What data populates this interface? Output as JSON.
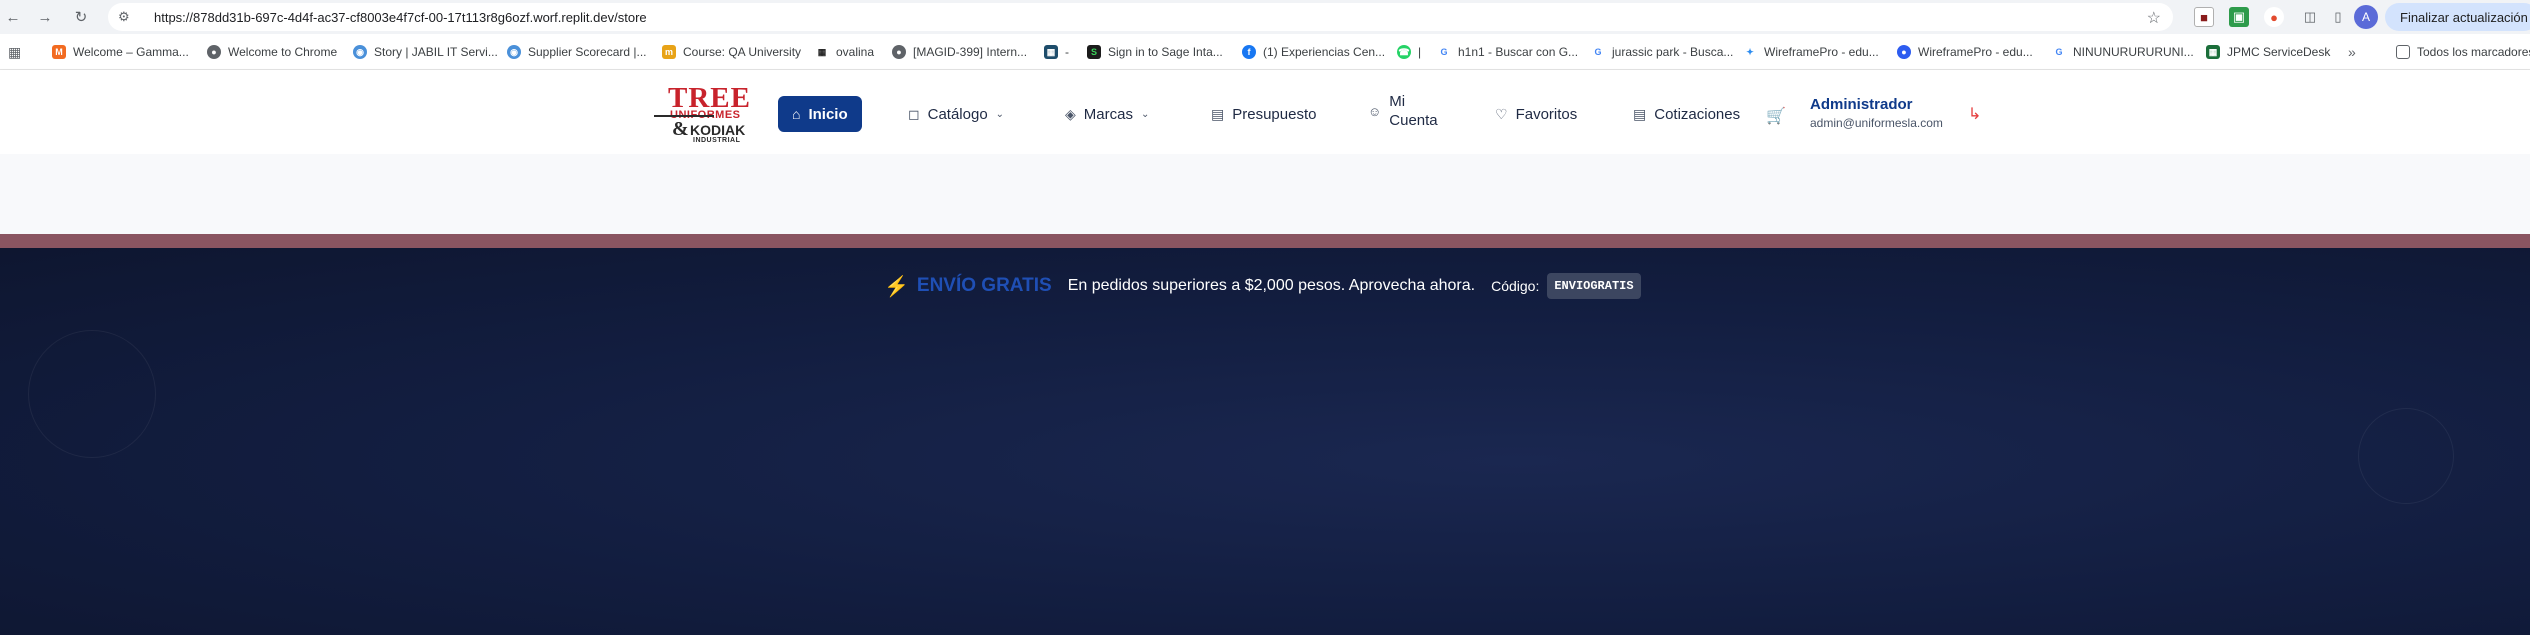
{
  "browser": {
    "url": "https://878dd31b-697c-4d4f-ac37-cf8003e4f7cf-00-17t113r8g6ozf.worf.replit.dev/store",
    "update_button": "Finalizar actualización",
    "profile_initial": "A",
    "bookmarks": [
      {
        "label": "Welcome – Gamma...",
        "color": "#f26b21"
      },
      {
        "label": "Welcome to Chrome",
        "color": "#5f6368"
      },
      {
        "label": "Story | JABIL IT Servi...",
        "color": "#4a90d9"
      },
      {
        "label": "Supplier Scorecard |...",
        "color": "#4a90d9"
      },
      {
        "label": "Course: QA University",
        "color": "#e8a317"
      },
      {
        "label": "ovalina",
        "color": "#222222"
      },
      {
        "label": "[MAGID-399] Intern...",
        "color": "#5f6368"
      },
      {
        "label": "-",
        "color": "#1e4d6b"
      },
      {
        "label": "Sign in to Sage Inta...",
        "color": "#1b1b1b"
      },
      {
        "label": "(1) Experiencias Cen...",
        "color": "#1877f2"
      },
      {
        "label": "|",
        "color": "#25d366"
      },
      {
        "label": "h1n1 - Buscar con G...",
        "color": "#4285f4"
      },
      {
        "label": "jurassic park - Busca...",
        "color": "#4285f4"
      },
      {
        "label": "WireframePro - edu...",
        "color": "#2d8cf0"
      },
      {
        "label": "WireframePro - edu...",
        "color": "#2d5cf0"
      },
      {
        "label": "NINUNURURURUNI...",
        "color": "#4285f4"
      },
      {
        "label": "JPMC ServiceDesk",
        "color": "#1b6e3a"
      }
    ],
    "all_bookmarks": "Todos los marcadores"
  },
  "header": {
    "logo": {
      "line1": "TREE",
      "line2": "UNIFORMES",
      "amp": "&",
      "line3": "KODIAK",
      "line4": "INDUSTRIAL"
    },
    "nav": {
      "inicio": "Inicio",
      "catalogo": "Catálogo",
      "marcas": "Marcas",
      "presupuesto": "Presupuesto",
      "mi_cuenta_1": "Mi",
      "mi_cuenta_2": "Cuenta",
      "favoritos": "Favoritos",
      "cotizaciones": "Cotizaciones"
    },
    "user": {
      "name": "Administrador",
      "email": "admin@uniformesla.com"
    }
  },
  "promo": {
    "title": "ENVÍO GRATIS",
    "message": "En pedidos superiores a $2,000 pesos. Aprovecha ahora.",
    "code_label": "Código:",
    "code": "ENVIOGRATIS"
  },
  "colors": {
    "primary": "#0f3a8a",
    "brand_red": "#c8232c",
    "hero_bg": "#121d3f",
    "strip": "#8a5561",
    "promo_title": "#1f4fb5",
    "bolt": "#f5b917"
  }
}
